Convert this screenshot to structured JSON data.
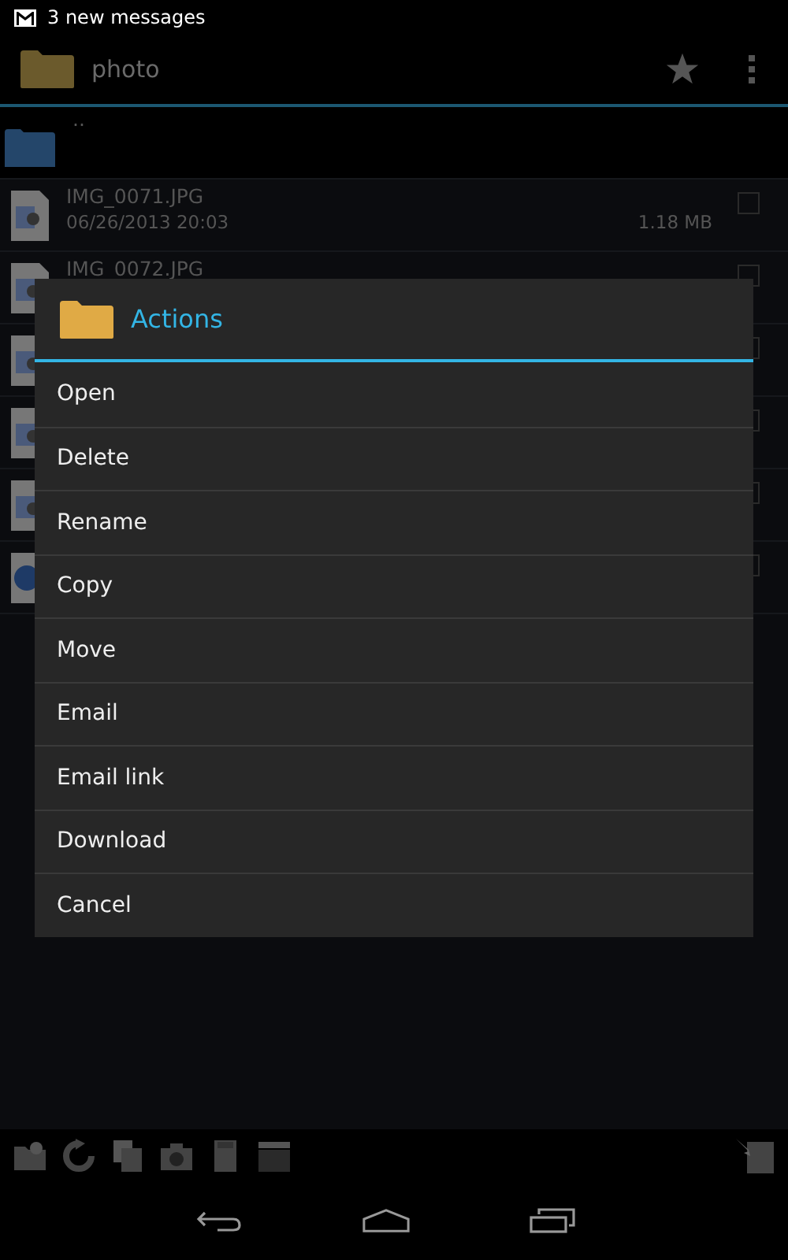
{
  "status_bar": {
    "notification": "3 new messages"
  },
  "action_bar": {
    "title": "photo"
  },
  "files": [
    {
      "kind": "parent",
      "name": ".."
    },
    {
      "kind": "image",
      "name": "IMG_0071.JPG",
      "date": "06/26/2013 20:03",
      "size": "1.18 MB",
      "checked": false
    },
    {
      "kind": "image",
      "name": "IMG_0072.JPG",
      "checked": false
    },
    {
      "kind": "image",
      "checked": false
    },
    {
      "kind": "image",
      "checked": false
    },
    {
      "kind": "image",
      "checked": false
    },
    {
      "kind": "video",
      "checked": false
    }
  ],
  "dialog": {
    "title": "Actions",
    "items": [
      "Open",
      "Delete",
      "Rename",
      "Copy",
      "Move",
      "Email",
      "Email link",
      "Download",
      "Cancel"
    ]
  }
}
